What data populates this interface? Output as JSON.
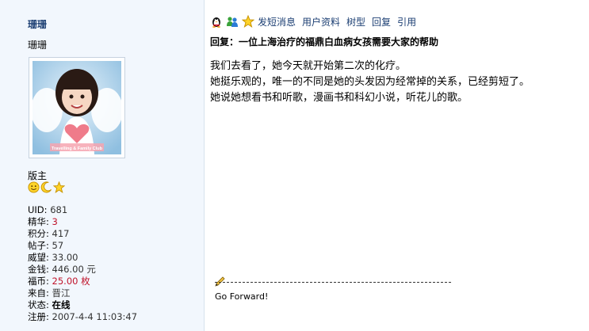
{
  "user": {
    "username": "珊珊",
    "nickname": "珊珊",
    "avatar_caption": "Travelling & Family Club",
    "role": "版主",
    "rank_icons": [
      "smiley-face-icon",
      "crescent-moon-icon",
      "star-icon"
    ],
    "stats": [
      {
        "label": "UID: ",
        "value": "681",
        "style": "val"
      },
      {
        "label": "精华: ",
        "value": "3",
        "style": "red"
      },
      {
        "label": "积分: ",
        "value": "417",
        "style": "val"
      },
      {
        "label": "帖子: ",
        "value": "57",
        "style": "val"
      },
      {
        "label": "威望: ",
        "value": "33.00",
        "style": "val"
      },
      {
        "label": "金钱: ",
        "value": "446.00 元",
        "style": "val"
      },
      {
        "label": "福币: ",
        "value": "25.00 枚",
        "style": "red"
      },
      {
        "label": "来自: ",
        "value": "晋江",
        "style": "val"
      },
      {
        "label": "状态: ",
        "value": "在线",
        "style": "bold"
      },
      {
        "label": "注册: ",
        "value": "2007-4-4 11:03:47",
        "style": "val"
      }
    ]
  },
  "actions": {
    "icons": [
      "qq-penguin-icon",
      "msn-icon",
      "star-icon"
    ],
    "send_message": "发短消息",
    "user_profile": "用户资料",
    "tree_view": "树型",
    "reply": "回复",
    "quote": "引用"
  },
  "post": {
    "title": "回复：一位上海治疗的福鼎白血病女孩需要大家的帮助",
    "lines": [
      "我们去看了，她今天就开始第二次的化疗。",
      "她挺乐观的，唯一的不同是她的头发因为经常掉的关系，已经剪短了。",
      "她说她想看书和听歌，漫画书和科幻小说，听花儿的歌。"
    ]
  },
  "signature": {
    "icon": "pencil-icon",
    "text": "Go Forward!"
  }
}
